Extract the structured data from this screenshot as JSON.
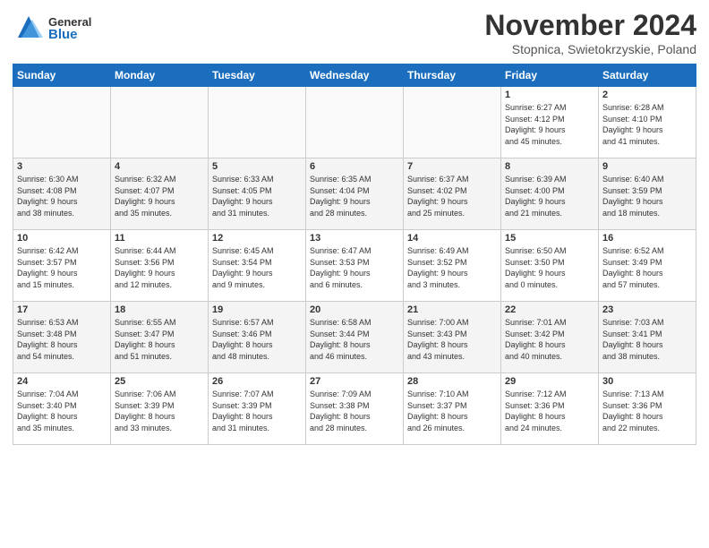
{
  "logo": {
    "general": "General",
    "blue": "Blue"
  },
  "header": {
    "month": "November 2024",
    "location": "Stopnica, Swietokrzyskie, Poland"
  },
  "weekdays": [
    "Sunday",
    "Monday",
    "Tuesday",
    "Wednesday",
    "Thursday",
    "Friday",
    "Saturday"
  ],
  "weeks": [
    [
      {
        "day": "",
        "detail": ""
      },
      {
        "day": "",
        "detail": ""
      },
      {
        "day": "",
        "detail": ""
      },
      {
        "day": "",
        "detail": ""
      },
      {
        "day": "",
        "detail": ""
      },
      {
        "day": "1",
        "detail": "Sunrise: 6:27 AM\nSunset: 4:12 PM\nDaylight: 9 hours\nand 45 minutes."
      },
      {
        "day": "2",
        "detail": "Sunrise: 6:28 AM\nSunset: 4:10 PM\nDaylight: 9 hours\nand 41 minutes."
      }
    ],
    [
      {
        "day": "3",
        "detail": "Sunrise: 6:30 AM\nSunset: 4:08 PM\nDaylight: 9 hours\nand 38 minutes."
      },
      {
        "day": "4",
        "detail": "Sunrise: 6:32 AM\nSunset: 4:07 PM\nDaylight: 9 hours\nand 35 minutes."
      },
      {
        "day": "5",
        "detail": "Sunrise: 6:33 AM\nSunset: 4:05 PM\nDaylight: 9 hours\nand 31 minutes."
      },
      {
        "day": "6",
        "detail": "Sunrise: 6:35 AM\nSunset: 4:04 PM\nDaylight: 9 hours\nand 28 minutes."
      },
      {
        "day": "7",
        "detail": "Sunrise: 6:37 AM\nSunset: 4:02 PM\nDaylight: 9 hours\nand 25 minutes."
      },
      {
        "day": "8",
        "detail": "Sunrise: 6:39 AM\nSunset: 4:00 PM\nDaylight: 9 hours\nand 21 minutes."
      },
      {
        "day": "9",
        "detail": "Sunrise: 6:40 AM\nSunset: 3:59 PM\nDaylight: 9 hours\nand 18 minutes."
      }
    ],
    [
      {
        "day": "10",
        "detail": "Sunrise: 6:42 AM\nSunset: 3:57 PM\nDaylight: 9 hours\nand 15 minutes."
      },
      {
        "day": "11",
        "detail": "Sunrise: 6:44 AM\nSunset: 3:56 PM\nDaylight: 9 hours\nand 12 minutes."
      },
      {
        "day": "12",
        "detail": "Sunrise: 6:45 AM\nSunset: 3:54 PM\nDaylight: 9 hours\nand 9 minutes."
      },
      {
        "day": "13",
        "detail": "Sunrise: 6:47 AM\nSunset: 3:53 PM\nDaylight: 9 hours\nand 6 minutes."
      },
      {
        "day": "14",
        "detail": "Sunrise: 6:49 AM\nSunset: 3:52 PM\nDaylight: 9 hours\nand 3 minutes."
      },
      {
        "day": "15",
        "detail": "Sunrise: 6:50 AM\nSunset: 3:50 PM\nDaylight: 9 hours\nand 0 minutes."
      },
      {
        "day": "16",
        "detail": "Sunrise: 6:52 AM\nSunset: 3:49 PM\nDaylight: 8 hours\nand 57 minutes."
      }
    ],
    [
      {
        "day": "17",
        "detail": "Sunrise: 6:53 AM\nSunset: 3:48 PM\nDaylight: 8 hours\nand 54 minutes."
      },
      {
        "day": "18",
        "detail": "Sunrise: 6:55 AM\nSunset: 3:47 PM\nDaylight: 8 hours\nand 51 minutes."
      },
      {
        "day": "19",
        "detail": "Sunrise: 6:57 AM\nSunset: 3:46 PM\nDaylight: 8 hours\nand 48 minutes."
      },
      {
        "day": "20",
        "detail": "Sunrise: 6:58 AM\nSunset: 3:44 PM\nDaylight: 8 hours\nand 46 minutes."
      },
      {
        "day": "21",
        "detail": "Sunrise: 7:00 AM\nSunset: 3:43 PM\nDaylight: 8 hours\nand 43 minutes."
      },
      {
        "day": "22",
        "detail": "Sunrise: 7:01 AM\nSunset: 3:42 PM\nDaylight: 8 hours\nand 40 minutes."
      },
      {
        "day": "23",
        "detail": "Sunrise: 7:03 AM\nSunset: 3:41 PM\nDaylight: 8 hours\nand 38 minutes."
      }
    ],
    [
      {
        "day": "24",
        "detail": "Sunrise: 7:04 AM\nSunset: 3:40 PM\nDaylight: 8 hours\nand 35 minutes."
      },
      {
        "day": "25",
        "detail": "Sunrise: 7:06 AM\nSunset: 3:39 PM\nDaylight: 8 hours\nand 33 minutes."
      },
      {
        "day": "26",
        "detail": "Sunrise: 7:07 AM\nSunset: 3:39 PM\nDaylight: 8 hours\nand 31 minutes."
      },
      {
        "day": "27",
        "detail": "Sunrise: 7:09 AM\nSunset: 3:38 PM\nDaylight: 8 hours\nand 28 minutes."
      },
      {
        "day": "28",
        "detail": "Sunrise: 7:10 AM\nSunset: 3:37 PM\nDaylight: 8 hours\nand 26 minutes."
      },
      {
        "day": "29",
        "detail": "Sunrise: 7:12 AM\nSunset: 3:36 PM\nDaylight: 8 hours\nand 24 minutes."
      },
      {
        "day": "30",
        "detail": "Sunrise: 7:13 AM\nSunset: 3:36 PM\nDaylight: 8 hours\nand 22 minutes."
      }
    ]
  ]
}
